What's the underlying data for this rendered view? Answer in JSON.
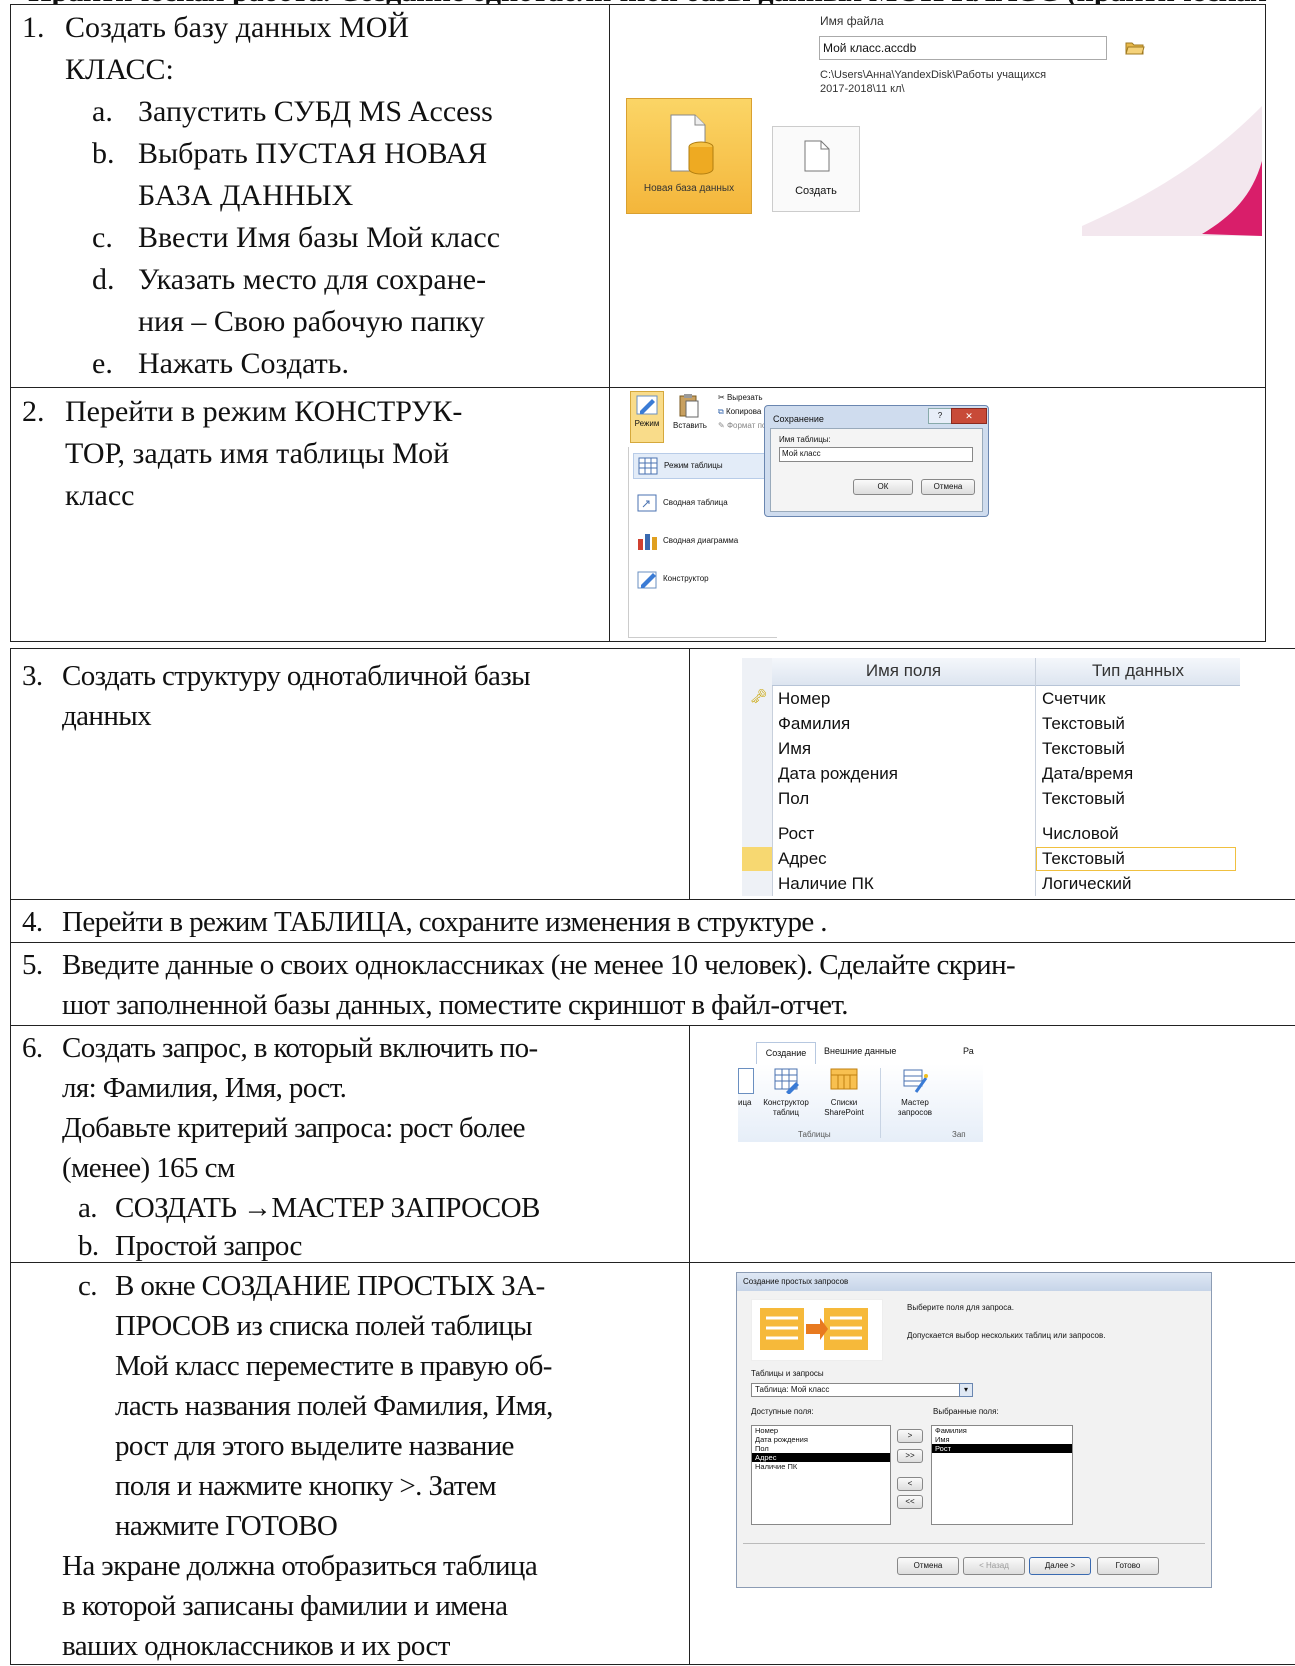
{
  "header_partial": "Практическая работа. Создание однотабличной базы данных МОЙ КЛАСС (практическая работа с СУБД)",
  "step1": {
    "num": "1.",
    "title_a": "Создать базу данных МОЙ",
    "title_b": "КЛАСС:",
    "items": [
      {
        "m": "a.",
        "t": "Запустить СУБД MS Access"
      },
      {
        "m": "b.",
        "t": "Выбрать ПУСТАЯ НОВАЯ"
      },
      {
        "m": "",
        "t": "БАЗА ДАННЫХ"
      },
      {
        "m": "c.",
        "t": "Ввести Имя базы Мой класс"
      },
      {
        "m": "d.",
        "t": "Указать место для сохране-"
      },
      {
        "m": "",
        "t": "ния – Свою рабочую папку"
      },
      {
        "m": "e.",
        "t": "Нажать Создать."
      }
    ],
    "shot": {
      "file_label": "Имя файла",
      "file_value": "Мой класс.accdb",
      "path_line1": "C:\\Users\\Анна\\YandexDisk\\Работы учащихся",
      "path_line2": "2017-2018\\11 кл\\",
      "new_db_label": "Новая база данных",
      "create_label": "Создать"
    }
  },
  "step2": {
    "num": "2.",
    "lines": [
      "Перейти в режим КОНСТРУК-",
      "ТОР, задать имя таблицы   Мой",
      "класс"
    ],
    "shot": {
      "mode_label": "Режим",
      "paste_label": "Вставить",
      "cut_label": "Вырезать",
      "copy_label": "Копирова",
      "format_label": "Формат по",
      "menu": [
        "Режим таблицы",
        "Сводная таблица",
        "Сводная диаграмма",
        "Конструктор"
      ],
      "dialog_title": "Сохранение",
      "dialog_field_label": "Имя таблицы:",
      "dialog_value": "Мой класс",
      "ok": "ОК",
      "cancel": "Отмена"
    }
  },
  "step3": {
    "num": "3.",
    "lines": [
      "Создать структуру однотабличной базы",
      "данных"
    ],
    "table": {
      "headers": [
        "Имя поля",
        "Тип данных"
      ],
      "rows": [
        [
          "Номер",
          "Счетчик"
        ],
        [
          "Фамилия",
          "Текстовый"
        ],
        [
          "Имя",
          "Текстовый"
        ],
        [
          "Дата рождения",
          "Дата/время"
        ],
        [
          "Пол",
          "Текстовый"
        ],
        [
          "Рост",
          "Числовой"
        ],
        [
          "Адрес",
          "Текстовый"
        ],
        [
          "Наличие ПК",
          "Логический"
        ]
      ]
    }
  },
  "step4": {
    "num": "4.",
    "text": "Перейти в режим ТАБЛИЦА, сохраните изменения в структуре ."
  },
  "step5": {
    "num": "5.",
    "line1": "Введите данные о своих одноклассниках (не менее 10 человек). Сделайте скрин-",
    "line2": "шот заполненной базы данных, поместите скриншот в файл-отчет."
  },
  "step6": {
    "num": "6.",
    "lines": [
      "Создать запрос, в который включить по-",
      "ля: Фамилия, Имя, рост.",
      "Добавьте критерий запроса: рост более",
      "(менее) 165 см"
    ],
    "items": [
      {
        "m": "a.",
        "t": "СОЗДАТЬ →МАСТЕР ЗАПРОСОВ"
      },
      {
        "m": "b.",
        "t": "Простой запрос"
      }
    ],
    "shot": {
      "tab_create": "Создание",
      "tab_external": "Внешние данные",
      "tab_more": "Ра",
      "btn_table": "ица",
      "btn_designer_1": "Конструктор",
      "btn_designer_2": "таблиц",
      "btn_lists_1": "Списки",
      "btn_lists_2": "SharePoint",
      "btn_wizard_1": "Мастер",
      "btn_wizard_2": "запросов",
      "group_tables": "Таблицы",
      "group_more": "Зап"
    }
  },
  "step6c": {
    "item_m": "c.",
    "lines": [
      "В окне СОЗДАНИЕ ПРОСТЫХ ЗА-",
      "ПРОСОВ из списка полей таблицы",
      "Мой класс переместите в правую об-",
      "ласть названия полей Фамилия, Имя,",
      "рост для этого выделите название",
      "поля и нажмите кнопку >. Затем",
      "нажмите ГОТОВО"
    ],
    "tail": [
      "На экране должна отобразиться таблица",
      "в которой записаны фамилии и имена",
      "ваших одноклассников и их рост"
    ],
    "shot": {
      "title": "Создание простых запросов",
      "hint1": "Выберите поля для запроса.",
      "hint2": "Допускается выбор нескольких таблиц или запросов.",
      "tables_label": "Таблицы и запросы",
      "tables_value": "Таблица: Мой класс",
      "avail_label": "Доступные поля:",
      "chosen_label": "Выбранные поля:",
      "avail": [
        "Номер",
        "Дата рождения",
        "Пол",
        "Адрес",
        "Наличие ПК"
      ],
      "chosen": [
        "Фамилия",
        "Имя",
        "Рост"
      ],
      "arrows": [
        ">",
        ">>",
        "<",
        "<<"
      ],
      "buttons": [
        "Отмена",
        "< Назад",
        "Далее >",
        "Готово"
      ]
    }
  }
}
